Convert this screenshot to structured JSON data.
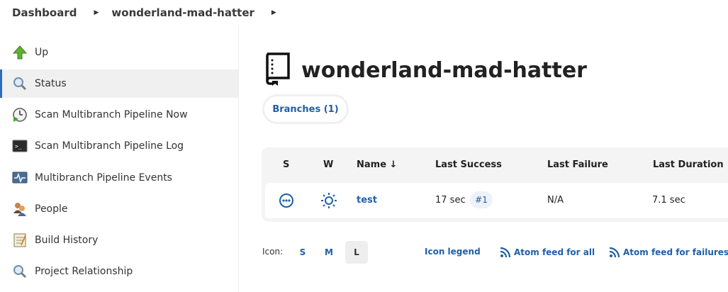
{
  "breadcrumb": {
    "items": [
      "Dashboard",
      "wonderland-mad-hatter"
    ]
  },
  "sidebar": {
    "items": [
      {
        "label": "Up",
        "icon": "up-arrow-icon"
      },
      {
        "label": "Status",
        "icon": "magnifier-icon",
        "active": true
      },
      {
        "label": "Scan Multibranch Pipeline Now",
        "icon": "clock-play-icon"
      },
      {
        "label": "Scan Multibranch Pipeline Log",
        "icon": "terminal-icon"
      },
      {
        "label": "Multibranch Pipeline Events",
        "icon": "monitor-pulse-icon"
      },
      {
        "label": "People",
        "icon": "people-icon"
      },
      {
        "label": "Build History",
        "icon": "notepad-icon"
      },
      {
        "label": "Project Relationship",
        "icon": "magnifier-icon"
      }
    ]
  },
  "main": {
    "title": "wonderland-mad-hatter",
    "tab": "Branches (1)",
    "table": {
      "headers": [
        "S",
        "W",
        "Name ↓",
        "Last Success",
        "Last Failure",
        "Last Duration"
      ],
      "rows": [
        {
          "name": "test",
          "last_success": "17 sec",
          "build": "#1",
          "last_failure": "N/A",
          "last_duration": "7.1 sec"
        }
      ]
    },
    "footer": {
      "icon_label": "Icon:",
      "sizes": [
        "S",
        "M",
        "L"
      ],
      "selected_size": "L",
      "icon_legend": "Icon legend",
      "feed_all": "Atom feed for all",
      "feed_failures": "Atom feed for failures"
    }
  },
  "colors": {
    "link": "#1f5fa8",
    "active_border": "#2a6ebb"
  }
}
